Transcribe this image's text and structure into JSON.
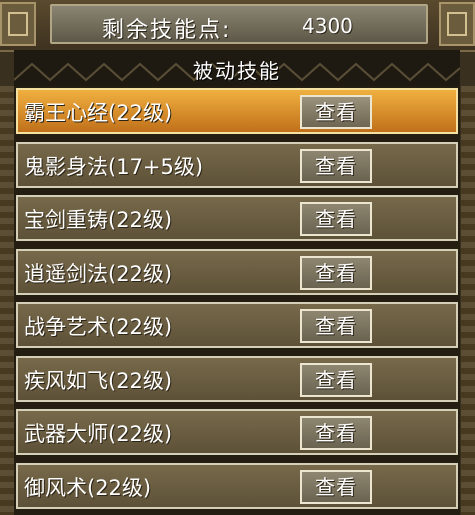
{
  "header": {
    "points_label": "剩余技能点:",
    "points_value": "4300"
  },
  "section": {
    "title": "被动技能"
  },
  "skills": [
    {
      "name": "霸王心经(22级)",
      "button": "查看",
      "selected": true
    },
    {
      "name": "鬼影身法(17+5级)",
      "button": "查看",
      "selected": false
    },
    {
      "name": "宝剑重铸(22级)",
      "button": "查看",
      "selected": false
    },
    {
      "name": "逍遥剑法(22级)",
      "button": "查看",
      "selected": false
    },
    {
      "name": "战争艺术(22级)",
      "button": "查看",
      "selected": false
    },
    {
      "name": "疾风如飞(22级)",
      "button": "查看",
      "selected": false
    },
    {
      "name": "武器大师(22级)",
      "button": "查看",
      "selected": false
    },
    {
      "name": "御风术(22级)",
      "button": "查看",
      "selected": false
    }
  ],
  "colors": {
    "selected_row": "#e09030",
    "normal_row": "#6b5e42",
    "text": "#ffffff"
  }
}
